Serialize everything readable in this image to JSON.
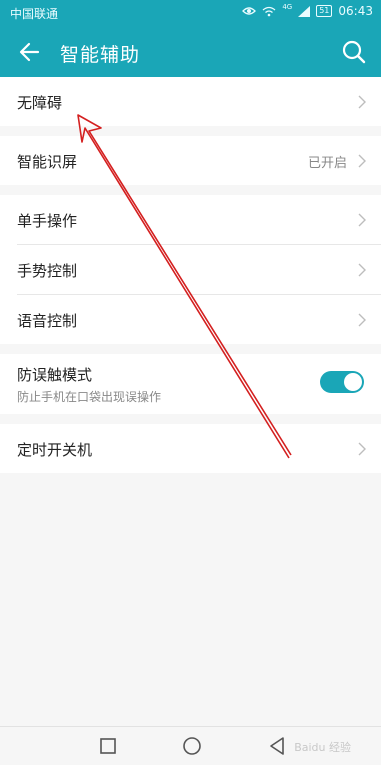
{
  "status_bar": {
    "carrier": "中国联通",
    "network_type": "4G",
    "battery": "51",
    "time": "06:43"
  },
  "app_bar": {
    "title": "智能辅助",
    "back_icon": "arrow-left-icon",
    "search_icon": "search-icon"
  },
  "settings": {
    "accessibility": {
      "label": "无障碍"
    },
    "smart_screen": {
      "label": "智能识屏",
      "status": "已开启"
    },
    "one_hand": {
      "label": "单手操作"
    },
    "gesture": {
      "label": "手势控制"
    },
    "voice": {
      "label": "语音控制"
    },
    "anti_touch": {
      "label": "防误触模式",
      "description": "防止手机在口袋出现误操作",
      "enabled": true
    },
    "scheduled_power": {
      "label": "定时开关机"
    }
  },
  "nav_bar": {
    "square_icon": "recent-apps-icon",
    "circle_icon": "home-icon",
    "triangle_icon": "back-icon"
  },
  "watermark": {
    "text": "Baidu 经验"
  },
  "annotation": {
    "color": "#d42020"
  },
  "colors": {
    "accent": "#1aa6b7",
    "background": "#f6f6f6"
  }
}
